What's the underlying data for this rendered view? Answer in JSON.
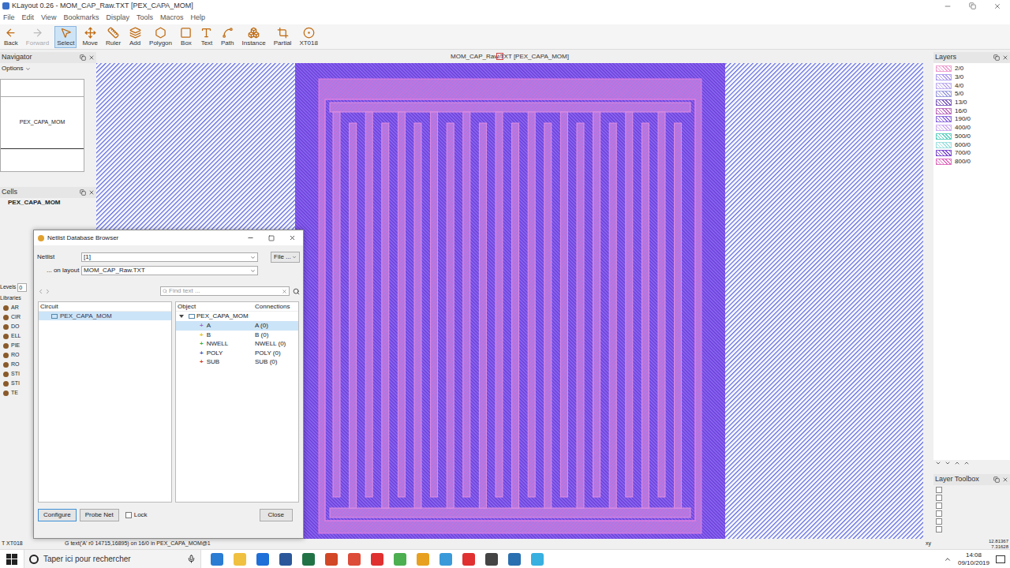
{
  "window": {
    "title": "KLayout 0.26 - MOM_CAP_Raw.TXT [PEX_CAPA_MOM]"
  },
  "menu": [
    "File",
    "Edit",
    "View",
    "Bookmarks",
    "Display",
    "Tools",
    "Macros",
    "Help"
  ],
  "toolbar": [
    {
      "label": "Back",
      "selected": false,
      "disabled": false
    },
    {
      "label": "Forward",
      "selected": false,
      "disabled": true
    },
    {
      "label": "Select",
      "selected": true,
      "disabled": false
    },
    {
      "label": "Move",
      "selected": false,
      "disabled": false
    },
    {
      "label": "Ruler",
      "selected": false,
      "disabled": false
    },
    {
      "label": "Add",
      "selected": false,
      "disabled": false
    },
    {
      "label": "Polygon",
      "selected": false,
      "disabled": false
    },
    {
      "label": "Box",
      "selected": false,
      "disabled": false
    },
    {
      "label": "Text",
      "selected": false,
      "disabled": false
    },
    {
      "label": "Path",
      "selected": false,
      "disabled": false
    },
    {
      "label": "Instance",
      "selected": false,
      "disabled": false
    },
    {
      "label": "Partial",
      "selected": false,
      "disabled": false
    },
    {
      "label": "XT018",
      "selected": false,
      "disabled": false
    }
  ],
  "navigator": {
    "title": "Navigator",
    "options": "Options",
    "cell": "PEX_CAPA_MOM"
  },
  "cells": {
    "title": "Cells",
    "items": [
      "PEX_CAPA_MOM"
    ]
  },
  "levels": {
    "label": "Levels",
    "value": "0"
  },
  "libraries": {
    "title": "Libraries",
    "items": [
      "AR",
      "CIR",
      "DO",
      "ELL",
      "PIE",
      "RO",
      "RO",
      "STI",
      "STI",
      "TE"
    ]
  },
  "tab": {
    "title": "MOM_CAP_Raw.TXT [PEX_CAPA_MOM]"
  },
  "layers": {
    "title": "Layers",
    "items": [
      {
        "name": "2/0",
        "color": "#f0a0d0"
      },
      {
        "name": "3/0",
        "color": "#b0a0f0"
      },
      {
        "name": "4/0",
        "color": "#c0b0f0"
      },
      {
        "name": "5/0",
        "color": "#a0a0e0"
      },
      {
        "name": "13/0",
        "color": "#8060c0"
      },
      {
        "name": "16/0",
        "color": "#c070c0"
      },
      {
        "name": "190/0",
        "color": "#9070e0"
      },
      {
        "name": "400/0",
        "color": "#d0b0f0"
      },
      {
        "name": "500/0",
        "color": "#60d0c0"
      },
      {
        "name": "600/0",
        "color": "#a0e0e0"
      },
      {
        "name": "700/0",
        "color": "#8050d0"
      },
      {
        "name": "800/0",
        "color": "#e070c0"
      }
    ]
  },
  "layer_toolbox": {
    "title": "Layer Toolbox"
  },
  "dialog": {
    "title": "Netlist Database Browser",
    "netlist_label": "Netlist",
    "netlist_value": "[1]",
    "file_button": "File ...",
    "layout_label": "... on layout",
    "layout_value": "MOM_CAP_Raw.TXT",
    "find_placeholder": "Find text ...",
    "circuit_header": "Circuit",
    "circuits": [
      {
        "name": "PEX_CAPA_MOM",
        "selected": true
      }
    ],
    "object_header": "Object",
    "connections_header": "Connections",
    "tree_root": {
      "name": "PEX_CAPA_MOM",
      "expanded": true
    },
    "nets": [
      {
        "name": "A",
        "connection": "A (0)",
        "selected": true,
        "color": "#9a6ad0"
      },
      {
        "name": "B",
        "connection": "B (0)",
        "selected": false,
        "color": "#e0c020"
      },
      {
        "name": "NWELL",
        "connection": "NWELL (0)",
        "selected": false,
        "color": "#30b050"
      },
      {
        "name": "POLY",
        "connection": "POLY (0)",
        "selected": false,
        "color": "#3050c0"
      },
      {
        "name": "SUB",
        "connection": "SUB (0)",
        "selected": false,
        "color": "#d03030"
      }
    ],
    "buttons": [
      "Configure",
      "Probe Net"
    ],
    "lock": {
      "label": "Lock",
      "checked": false
    },
    "close": "Close"
  },
  "status_bar": {
    "mode": "XT018",
    "message": "G  text('A' r0 14715,16895) on 16/0 in PEX_CAPA_MOM@1",
    "xy": "xy",
    "x": "12.81367",
    "y": "7.31628"
  },
  "taskbar": {
    "search": "Taper ici pour rechercher",
    "time": "14:08",
    "date": "09/10/2019"
  }
}
